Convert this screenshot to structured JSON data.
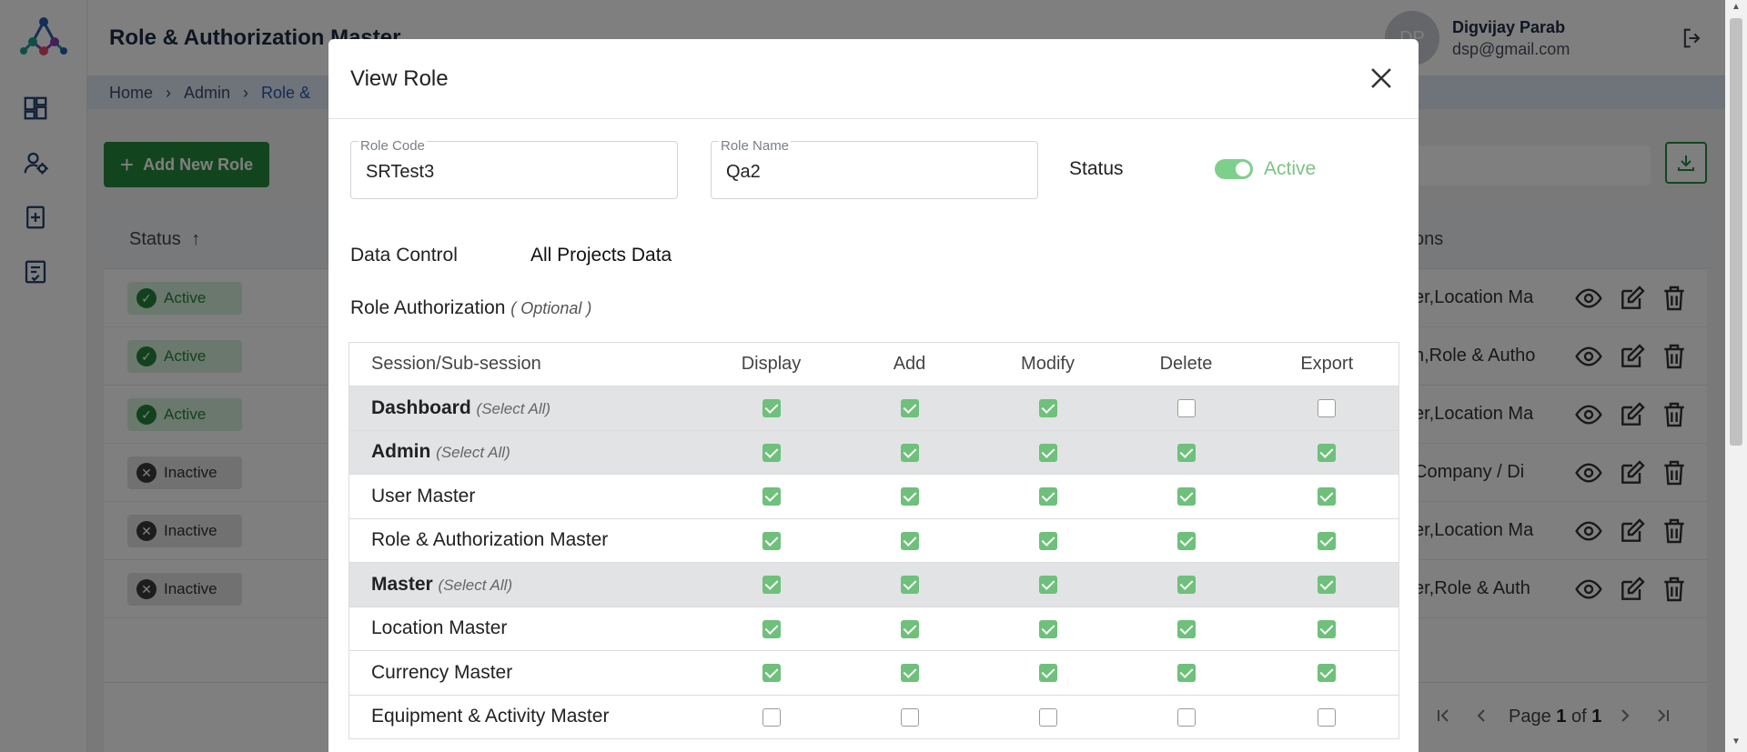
{
  "app": {
    "title": "Role & Authorization Master",
    "breadcrumb": [
      "Home",
      "Admin",
      "Role &"
    ],
    "user": {
      "initials": "DP",
      "name": "Digvijay Parab",
      "email": "dsp@gmail.com"
    },
    "add_button": "Add New Role",
    "table": {
      "status_header": "Status",
      "actions_header": "ons",
      "rows": [
        {
          "status": "Active",
          "modules": "er,Location Ma"
        },
        {
          "status": "Active",
          "modules": "n,Role & Autho"
        },
        {
          "status": "Active",
          "modules": "er,Location Ma"
        },
        {
          "status": "Inactive",
          "modules": "Company / Di"
        },
        {
          "status": "Inactive",
          "modules": "er,Location Ma"
        },
        {
          "status": "Inactive",
          "modules": "er,Role & Auth"
        }
      ]
    },
    "pager": {
      "page_word": "Page",
      "current": "1",
      "of_word": "of",
      "total": "1"
    }
  },
  "modal": {
    "title": "View Role",
    "role_code": {
      "label": "Role Code",
      "value": "SRTest3"
    },
    "role_name": {
      "label": "Role Name",
      "value": "Qa2"
    },
    "status": {
      "label": "Status",
      "value": "Active",
      "on": true
    },
    "data_control": {
      "label": "Data Control",
      "value": "All Projects Data"
    },
    "role_authorization": {
      "label": "Role Authorization",
      "note": "( Optional )"
    },
    "select_all_text": "(Select All)",
    "columns": [
      "Session/Sub-session",
      "Display",
      "Add",
      "Modify",
      "Delete",
      "Export"
    ],
    "rows": [
      {
        "name": "Dashboard",
        "group": true,
        "perms": [
          true,
          true,
          true,
          false,
          false
        ]
      },
      {
        "name": "Admin",
        "group": true,
        "perms": [
          true,
          true,
          true,
          true,
          true
        ]
      },
      {
        "name": "User Master",
        "group": false,
        "perms": [
          true,
          true,
          true,
          true,
          true
        ]
      },
      {
        "name": "Role & Authorization Master",
        "group": false,
        "perms": [
          true,
          true,
          true,
          true,
          true
        ]
      },
      {
        "name": "Master",
        "group": true,
        "perms": [
          true,
          true,
          true,
          true,
          true
        ]
      },
      {
        "name": "Location Master",
        "group": false,
        "perms": [
          true,
          true,
          true,
          true,
          true
        ]
      },
      {
        "name": "Currency Master",
        "group": false,
        "perms": [
          true,
          true,
          true,
          true,
          true
        ]
      },
      {
        "name": "Equipment & Activity Master",
        "group": false,
        "perms": [
          false,
          false,
          false,
          false,
          false
        ]
      }
    ]
  }
}
